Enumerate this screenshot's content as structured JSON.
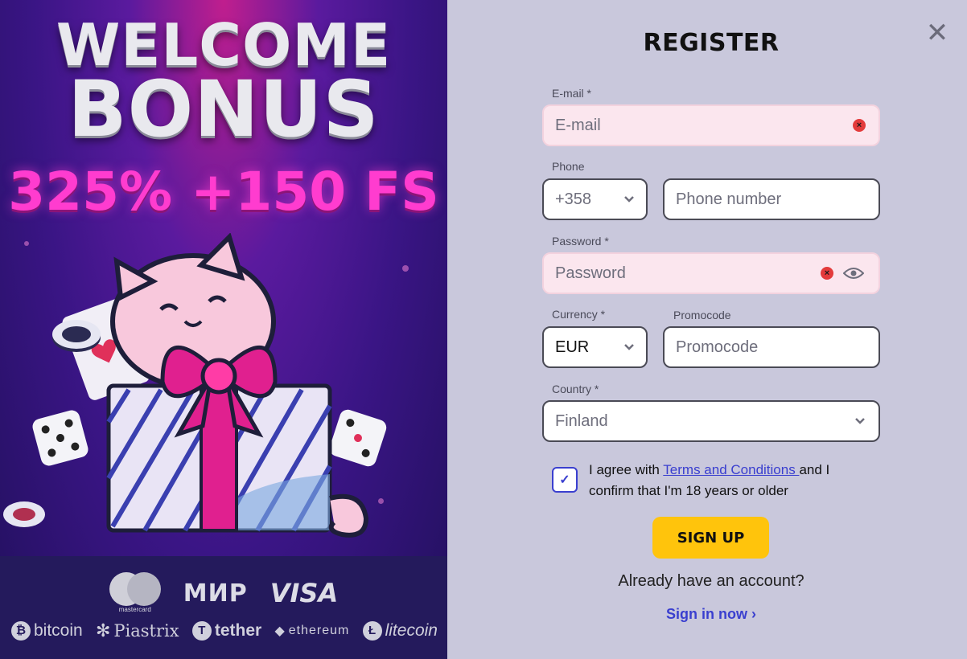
{
  "promo": {
    "line1": "WELCOME",
    "line2": "BONUS",
    "offer": "325% +150 FS",
    "payments": {
      "mastercard": "mastercard",
      "mir": "МИР",
      "visa": "VISA",
      "bitcoin": "bitcoin",
      "piastrix": "Piastrix",
      "tether": "tether",
      "ethereum": "ethereum",
      "litecoin": "litecoin"
    }
  },
  "form": {
    "title": "REGISTER",
    "email": {
      "label": "E-mail *",
      "placeholder": "E-mail"
    },
    "phone": {
      "label": "Phone",
      "code": "+358",
      "placeholder": "Phone number"
    },
    "password": {
      "label": "Password *",
      "placeholder": "Password"
    },
    "currency": {
      "label": "Currency *",
      "value": "EUR"
    },
    "promocode": {
      "label": "Promocode",
      "placeholder": "Promocode"
    },
    "country": {
      "label": "Country *",
      "value": "Finland"
    },
    "agree": {
      "checked": true,
      "prefix": "I agree with ",
      "link": "Terms and Conditions ",
      "suffix": "and I confirm that I'm 18 years or older"
    },
    "signup_label": "SIGN UP",
    "already_text": "Already have an account?",
    "signin_label": "Sign in now"
  },
  "colors": {
    "accent": "#ffc40c",
    "link": "#3a3fcf",
    "error_bg": "#fbe6ee",
    "panel_bg": "#c9c8dc"
  },
  "icons": [
    "close-icon",
    "error-icon",
    "eye-icon",
    "chevron-down-icon",
    "check-icon",
    "chevron-right-icon"
  ]
}
